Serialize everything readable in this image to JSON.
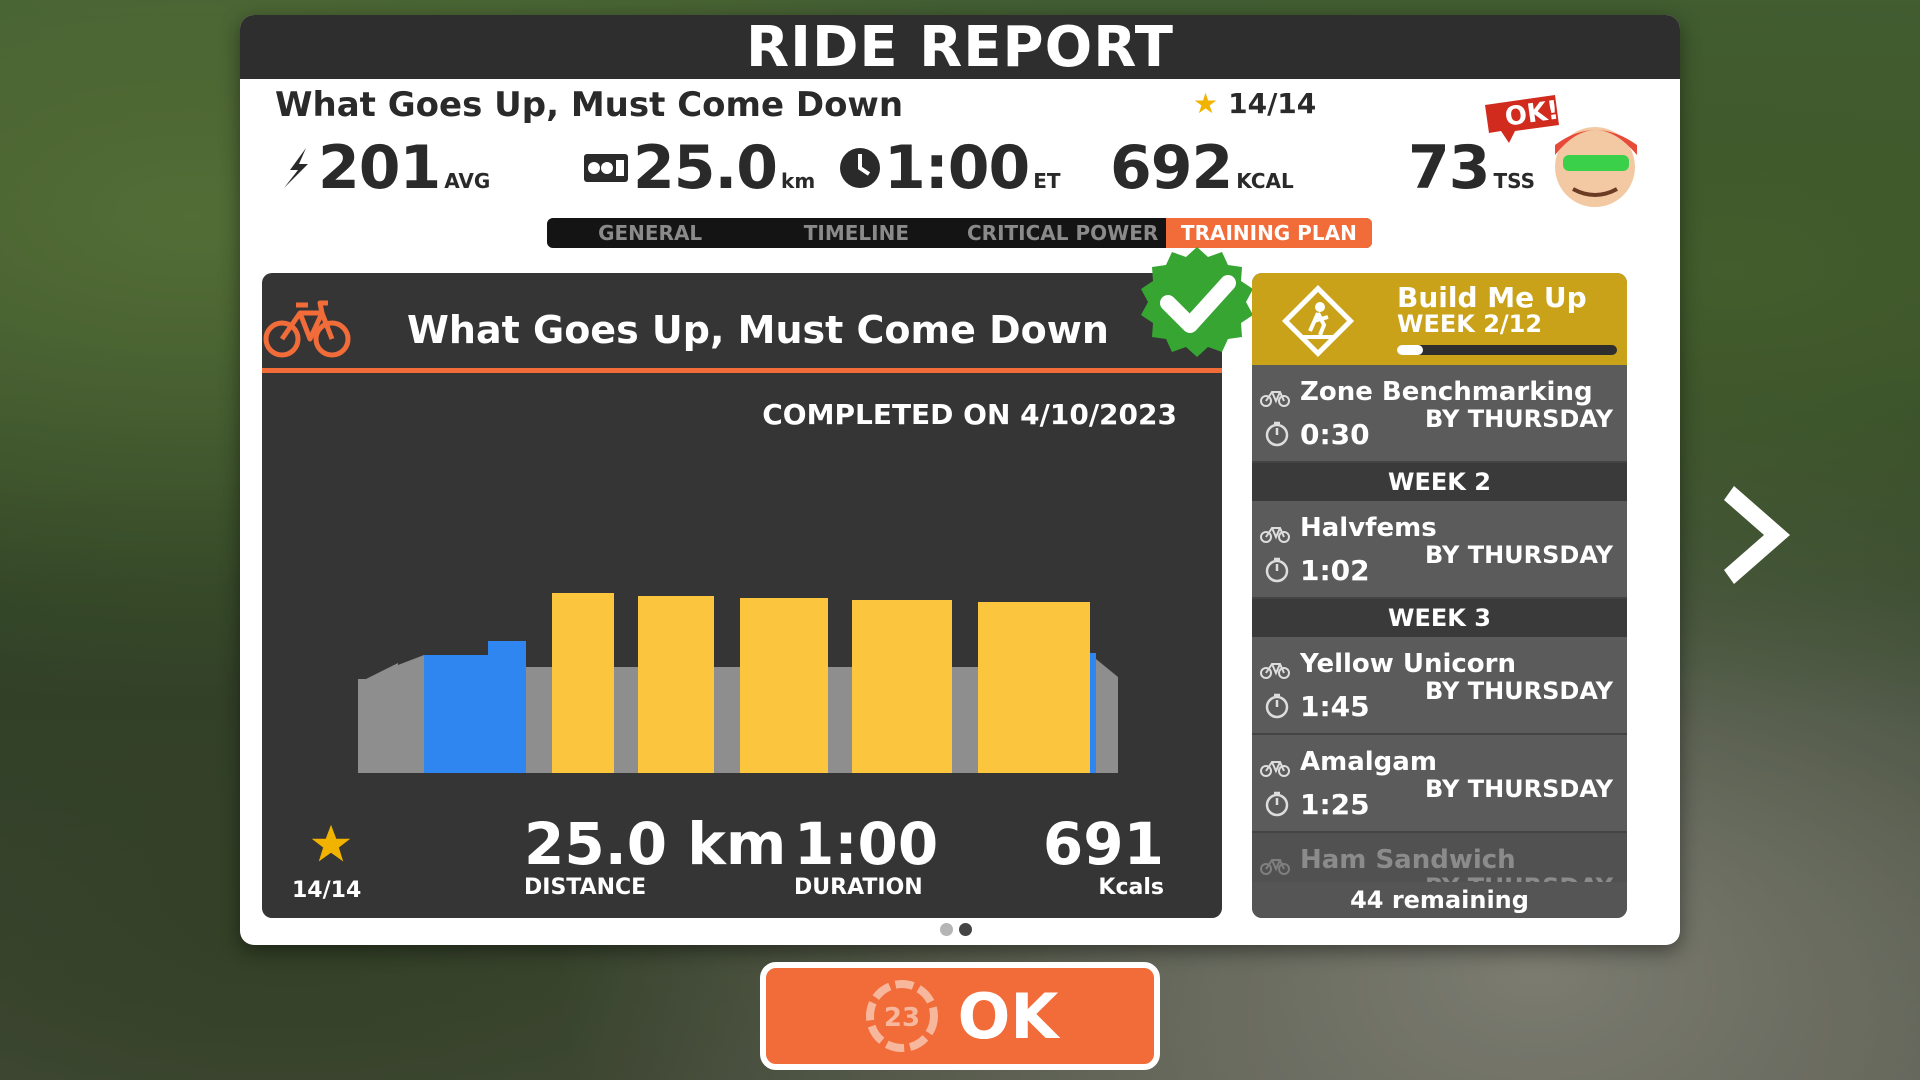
{
  "header": {
    "title": "RIDE REPORT"
  },
  "ride": {
    "title": "What Goes Up, Must Come Down",
    "stars": "14/14"
  },
  "stats": {
    "power": {
      "value": "201",
      "unit": "AVG",
      "icon": "lightning-icon"
    },
    "distance": {
      "value": "25.0",
      "unit": "km",
      "icon": "odometer-icon"
    },
    "time": {
      "value": "1:00",
      "unit": "ET",
      "icon": "clock-icon"
    },
    "calories": {
      "value": "692",
      "unit": "KCAL"
    },
    "tss": {
      "value": "73",
      "unit": "TSS"
    }
  },
  "coach": {
    "bubble": "OK!"
  },
  "tabs": [
    {
      "label": "GENERAL",
      "active": false
    },
    {
      "label": "TIMELINE",
      "active": false
    },
    {
      "label": "CRITICAL POWER",
      "active": false
    },
    {
      "label": "TRAINING PLAN",
      "active": true
    }
  ],
  "workout_card": {
    "title": "What Goes Up, Must Come Down",
    "completed": "COMPLETED ON 4/10/2023",
    "stars": "14/14",
    "distance": {
      "value": "25.0 km",
      "label": "DISTANCE"
    },
    "duration": {
      "value": "1:00",
      "label": "DURATION"
    },
    "calories": {
      "value": "691",
      "label": "Kcals"
    }
  },
  "plan": {
    "name": "Build Me Up",
    "week": "WEEK 2/12",
    "progress": 0.12,
    "items": [
      {
        "type": "workout",
        "name": "Zone Benchmarking",
        "duration": "0:30",
        "due": "BY THURSDAY"
      },
      {
        "type": "week",
        "label": "WEEK 2"
      },
      {
        "type": "workout",
        "name": "Halvfems",
        "duration": "1:02",
        "due": "BY THURSDAY"
      },
      {
        "type": "week",
        "label": "WEEK 3"
      },
      {
        "type": "workout",
        "name": "Yellow Unicorn",
        "duration": "1:45",
        "due": "BY THURSDAY"
      },
      {
        "type": "workout",
        "name": "Amalgam",
        "duration": "1:25",
        "due": "BY THURSDAY"
      },
      {
        "type": "workout",
        "name": "Ham Sandwich",
        "duration": "",
        "due": "BY THURSDAY",
        "faded": true
      }
    ],
    "remaining": "44 remaining"
  },
  "ok_button": {
    "label": "OK",
    "badge": "23"
  },
  "colors": {
    "accent": "#f26c3a",
    "zone_blue": "#2f86f0",
    "zone_yellow": "#fbc53d",
    "zone_gray": "#8e8e8e",
    "plan_gold": "#c9a21a"
  }
}
